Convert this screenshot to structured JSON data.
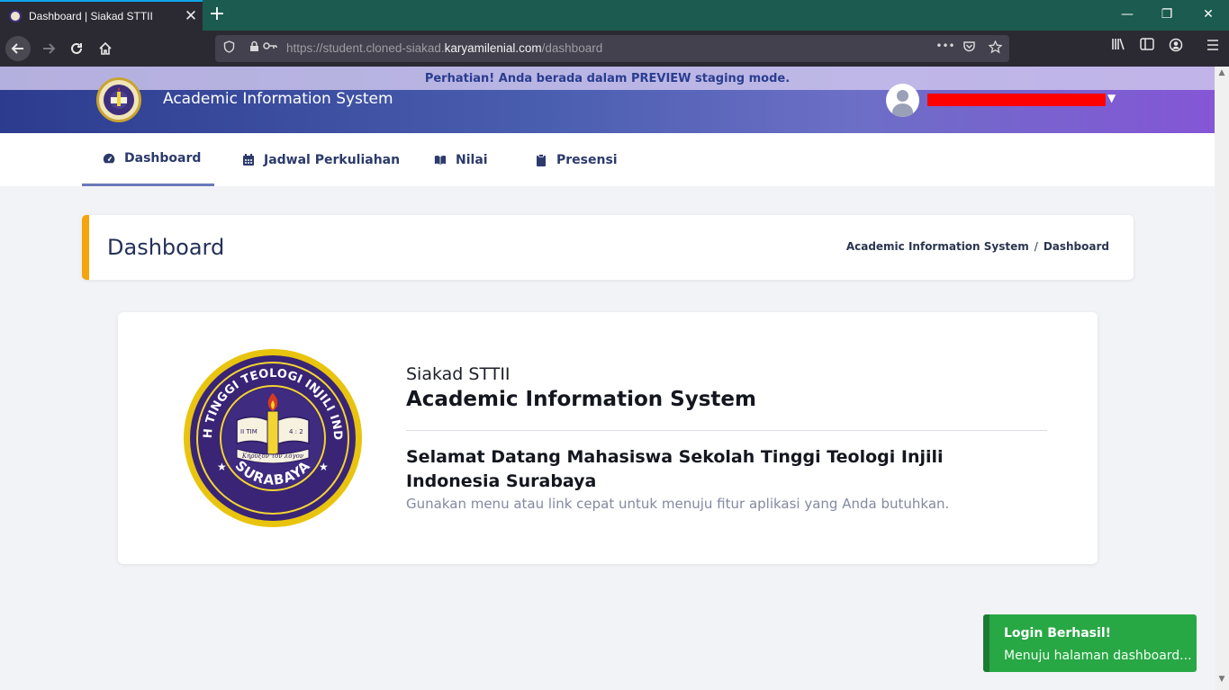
{
  "browser": {
    "tab_title": "Dashboard | Siakad STTII",
    "tab_close": "✕",
    "new_tab": "+",
    "window_controls": [
      "—",
      "❐",
      "✕"
    ],
    "url_prefix": "https://student.cloned-siakad.",
    "url_host": "karyamilenial.com",
    "url_path": "/dashboard",
    "url_more": "•••"
  },
  "banner": {
    "preview_text": "Perhatian! Anda berada dalam PREVIEW staging mode."
  },
  "header": {
    "app_title": "Academic Information System"
  },
  "nav": {
    "items": [
      {
        "label": "Dashboard",
        "icon": "gauge-icon",
        "active": true
      },
      {
        "label": "Jadwal Perkuliahan",
        "icon": "calendar-icon",
        "active": false
      },
      {
        "label": "Nilai",
        "icon": "book-icon",
        "active": false
      },
      {
        "label": "Presensi",
        "icon": "clipboard-icon",
        "active": false
      }
    ]
  },
  "page": {
    "title": "Dashboard",
    "breadcrumb": [
      "Academic Information System",
      "Dashboard"
    ],
    "breadcrumb_sep": "/"
  },
  "welcome": {
    "subtitle": "Siakad STTII",
    "title": "Academic Information System",
    "heading": "Selamat Datang Mahasiswa Sekolah Tinggi Teologi Injili Indonesia Surabaya",
    "description": "Gunakan menu atau link cepat untuk menuju fitur aplikasi yang Anda butuhkan."
  },
  "logo": {
    "ring_text": "SEKOLAH TINGGI TEOLOGI INJILI INDONESIA",
    "bottom_text": "SURABAYA",
    "book_left": "II TIM",
    "book_right": "4 : 2",
    "banner_text": "Κήρυξον τὸν λόγον"
  },
  "toast": {
    "title": "Login Berhasil!",
    "body": "Menuju halaman dashboard..."
  },
  "colors": {
    "accent_orange": "#f4a40c",
    "header_start": "#2c3b8d",
    "header_end": "#8456d6",
    "toast_green": "#28a745",
    "nav_text": "#2c3a6c"
  }
}
